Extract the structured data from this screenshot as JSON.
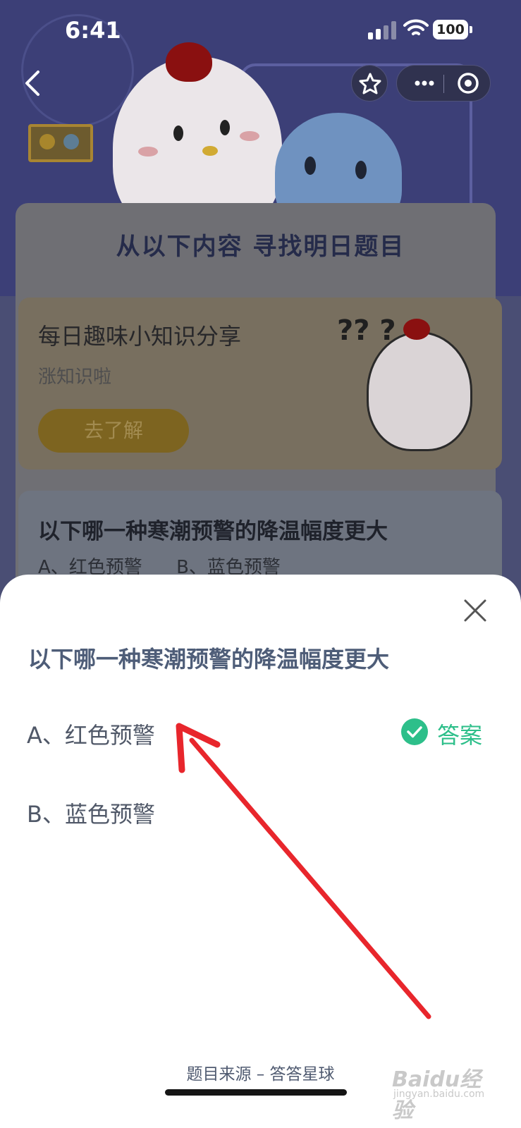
{
  "status_bar": {
    "time": "6:41",
    "battery": "100",
    "icons": [
      "signal-icon",
      "wifi-icon",
      "battery-icon"
    ]
  },
  "nav": {
    "back_icon": "chevron-left-icon",
    "favorite_icon": "star-icon",
    "more_icon": "more-dots-icon",
    "close_icon": "target-close-icon"
  },
  "background_page": {
    "section_title": "从以下内容 寻找明日题目",
    "promo": {
      "title": "每日趣味小知识分享",
      "subtitle": "涨知识啦",
      "button_label": "去了解",
      "question_marks": "?? ?"
    },
    "quiz_preview": {
      "question": "以下哪一种寒潮预警的降温幅度更大",
      "options": [
        "A、红色预警",
        "B、蓝色预警"
      ]
    }
  },
  "sheet": {
    "close_icon": "close-x-icon",
    "question": "以下哪一种寒潮预警的降温幅度更大",
    "options": [
      {
        "label": "A、红色预警",
        "is_answer": true
      },
      {
        "label": "B、蓝色预警",
        "is_answer": false
      }
    ],
    "answer_label": "答案",
    "answer_icon": "check-circle-icon",
    "answer_color": "#2dbf8a",
    "source_text": "题目来源 – 答答星球"
  },
  "watermark": {
    "brand": "Baidu经验",
    "url": "jingyan.baidu.com"
  },
  "annotation": {
    "arrow_color": "#e8262c"
  }
}
